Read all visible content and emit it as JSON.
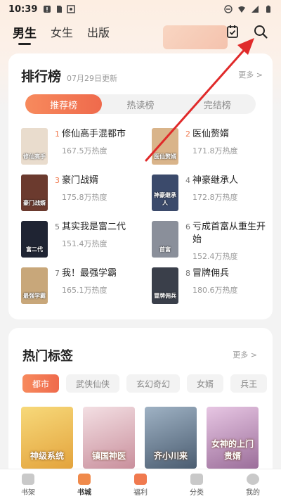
{
  "status_bar": {
    "time": "10:39"
  },
  "header": {
    "tabs": [
      {
        "label": "男生",
        "active": true
      },
      {
        "label": "女生",
        "active": false
      },
      {
        "label": "出版",
        "active": false
      }
    ]
  },
  "ranking": {
    "title": "排行榜",
    "updated": "07月29日更新",
    "more": "更多 >",
    "tabs": [
      {
        "label": "推荐榜",
        "active": true
      },
      {
        "label": "热读榜",
        "active": false
      },
      {
        "label": "完结榜",
        "active": false
      }
    ],
    "books": [
      {
        "rank": "1",
        "title": "修仙高手混都市",
        "heat": "167.5万热度",
        "cover_text": "修仙高手",
        "cover_color": "#e9dccd"
      },
      {
        "rank": "2",
        "title": "医仙赘婿",
        "heat": "171.8万热度",
        "cover_text": "医仙赘婿",
        "cover_color": "#d9b48a"
      },
      {
        "rank": "3",
        "title": "豪门战婿",
        "heat": "175.8万热度",
        "cover_text": "豪门战婿",
        "cover_color": "#6b3a2e"
      },
      {
        "rank": "4",
        "title": "神豪继承人",
        "heat": "172.8万热度",
        "cover_text": "神豪继承人",
        "cover_color": "#3b4a6b"
      },
      {
        "rank": "5",
        "title": "其实我是富二代",
        "heat": "151.4万热度",
        "cover_text": "富二代",
        "cover_color": "#1f2433"
      },
      {
        "rank": "6",
        "title": "亏成首富从重生开始",
        "heat": "152.4万热度",
        "cover_text": "首富",
        "cover_color": "#8a8f9a"
      },
      {
        "rank": "7",
        "title": "我！最强学霸",
        "heat": "165.1万热度",
        "cover_text": "最强学霸",
        "cover_color": "#c8a77a"
      },
      {
        "rank": "8",
        "title": "冒牌佣兵",
        "heat": "180.6万热度",
        "cover_text": "冒牌佣兵",
        "cover_color": "#3a3f4a"
      }
    ]
  },
  "tags": {
    "title": "热门标签",
    "more": "更多 >",
    "chips": [
      {
        "label": "都市",
        "active": true
      },
      {
        "label": "武侠仙侠",
        "active": false
      },
      {
        "label": "玄幻奇幻",
        "active": false
      },
      {
        "label": "女婿",
        "active": false
      },
      {
        "label": "兵王",
        "active": false
      }
    ],
    "covers": [
      {
        "text": "神级系统",
        "color": "#f1c15a"
      },
      {
        "text": "镇国神医",
        "color": "#e6c3c8"
      },
      {
        "text": "齐小川来",
        "color": "#6a7f95"
      },
      {
        "text": "女神的上门贵婿",
        "color": "#c9a3c7"
      }
    ]
  },
  "bottom_nav": [
    {
      "label": "书架",
      "active": false
    },
    {
      "label": "书城",
      "active": true
    },
    {
      "label": "福利",
      "active": false
    },
    {
      "label": "分类",
      "active": false
    },
    {
      "label": "我的",
      "active": false
    }
  ],
  "colors": {
    "accent": "#ef6a4c",
    "rank_top": "#f07a4f",
    "rank_other": "#777777",
    "annotation_arrow": "#e02a2a"
  }
}
